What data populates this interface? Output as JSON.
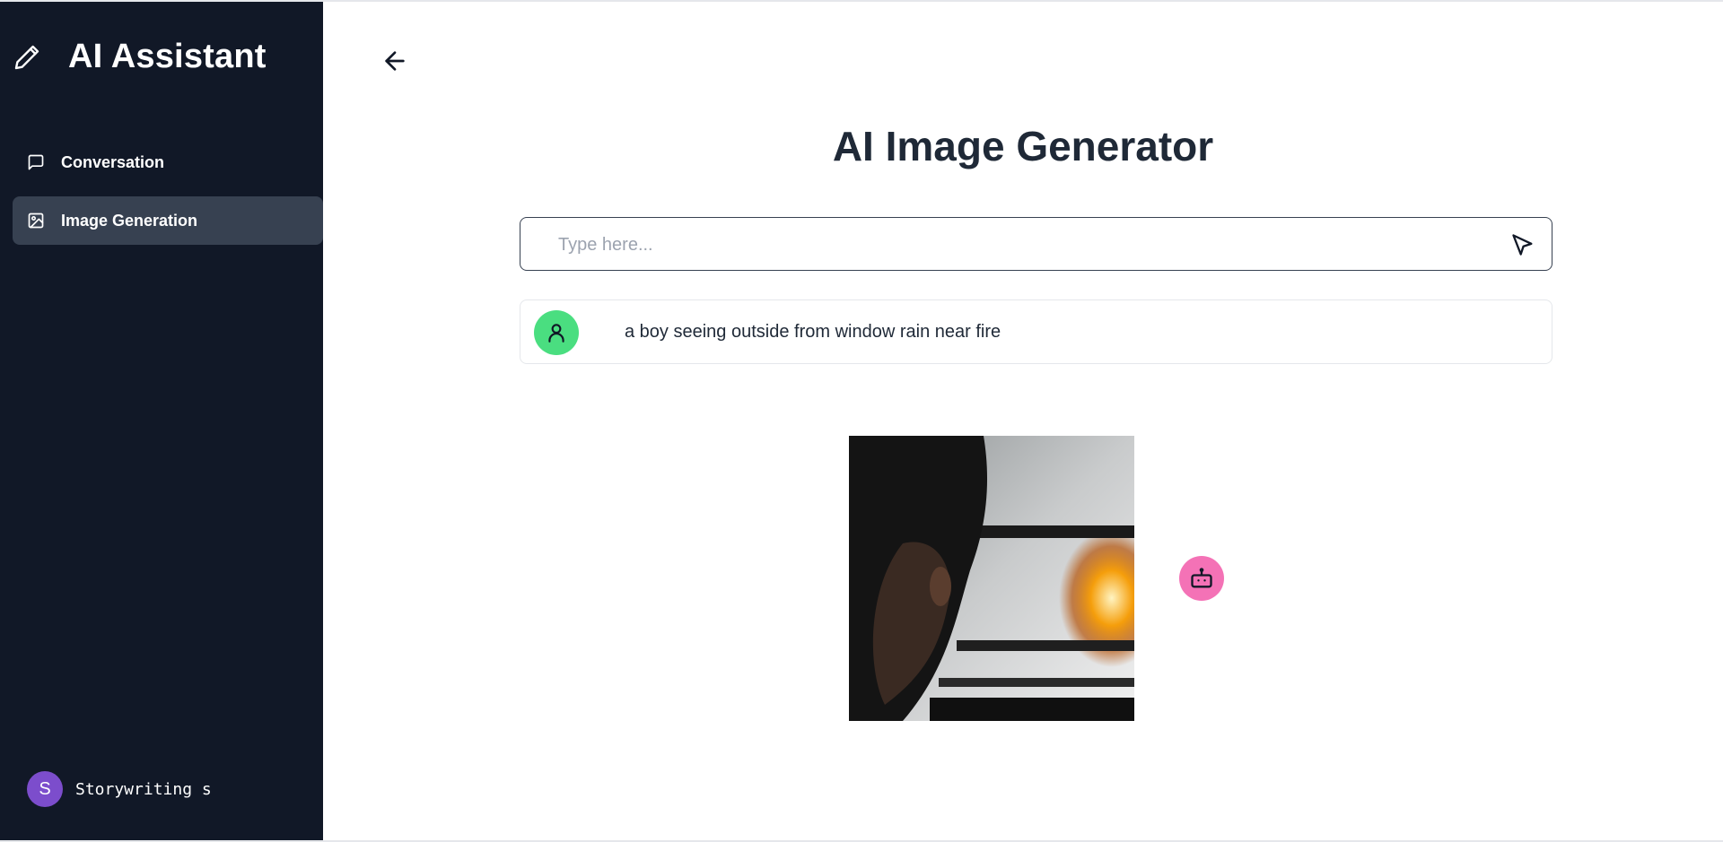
{
  "app": {
    "title": "AI Assistant",
    "icon": "pencil-icon"
  },
  "sidebar": {
    "items": [
      {
        "label": "Conversation",
        "icon": "message-square-icon",
        "active": false
      },
      {
        "label": "Image Generation",
        "icon": "image-icon",
        "active": true
      }
    ],
    "user": {
      "initial": "S",
      "name": "Storywriting s"
    }
  },
  "main": {
    "back_icon": "arrow-left-icon",
    "title": "AI Image Generator",
    "prompt": {
      "placeholder": "Type here...",
      "value": "",
      "send_icon": "send-cursor-icon"
    },
    "messages": [
      {
        "role": "user",
        "icon": "user-icon",
        "text": "a boy seeing outside from window rain near fire"
      },
      {
        "role": "bot",
        "icon": "bot-icon",
        "image_description_icon": "generated-image"
      }
    ]
  },
  "colors": {
    "sidebar_bg": "#111827",
    "active_item_bg": "#374151",
    "user_avatar": "#4ade80",
    "bot_avatar": "#f472b6",
    "profile_avatar": "#7c4dcc",
    "title_text": "#1f2937"
  }
}
